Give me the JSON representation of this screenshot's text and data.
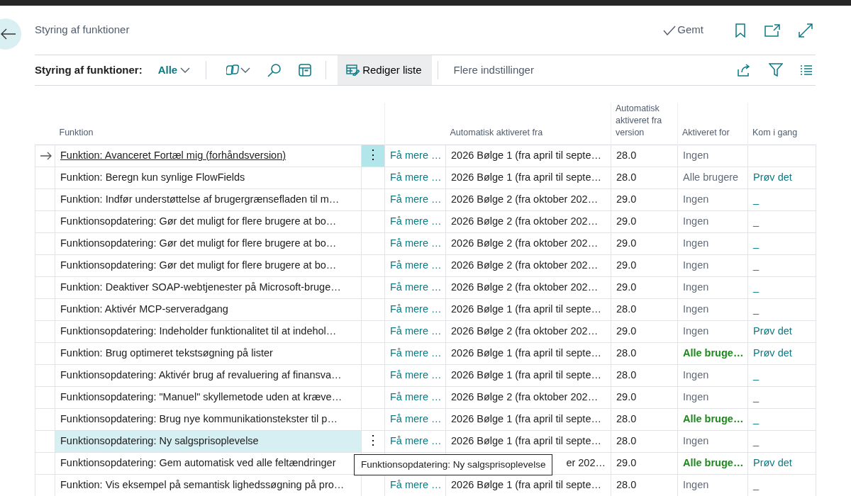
{
  "header": {
    "title": "Styring af funktioner",
    "save_status": "Gemt"
  },
  "toolbar": {
    "label": "Styring af funktioner:",
    "view": "Alle",
    "edit_button": "Rediger liste",
    "more": "Flere indstillinger"
  },
  "table": {
    "columns": [
      "Funktion",
      "Automatisk aktiveret fra",
      "Automatisk aktiveret fra version",
      "Aktiveret for",
      "Kom i gang"
    ],
    "rows": [
      {
        "feature": "Funktion: Avanceret Fortæl mig (forhåndsversion)",
        "selected": true,
        "hovered": false,
        "actions": "⋮",
        "learn": "Få mere …",
        "auto_from": "2026 Bølge 1 (fra april til septe…",
        "version": "28.0",
        "enabled_for": "Ingen",
        "enabled_all": false
      },
      {
        "feature": "Funktion: Beregn kun synlige FlowFields",
        "selected": false,
        "hovered": false,
        "learn": "Få mere …",
        "auto_from": "2026 Bølge 1 (fra april til septe…",
        "version": "28.0",
        "enabled_for": "Alle brugere",
        "enabled_all": false,
        "start": "Prøv det"
      },
      {
        "feature": "Funktion: Indfør understøttelse af brugergrænsefladen til m…",
        "selected": false,
        "hovered": false,
        "learn": "Få mere …",
        "auto_from": "2026 Bølge 2 (fra oktober 202…",
        "version": "29.0",
        "enabled_for": "Ingen",
        "enabled_all": false,
        "start": "_"
      },
      {
        "feature": "Funktionsopdatering: Gør det muligt for flere brugere at bo…",
        "selected": false,
        "hovered": false,
        "learn": "Få mere …",
        "auto_from": "2026 Bølge 2 (fra oktober 202…",
        "version": "29.0",
        "enabled_for": "Ingen",
        "enabled_all": false,
        "start": "_"
      },
      {
        "feature": "Funktionsopdatering: Gør det muligt for flere brugere at bo…",
        "selected": false,
        "hovered": false,
        "learn": "Få mere …",
        "auto_from": "2026 Bølge 2 (fra oktober 202…",
        "version": "29.0",
        "enabled_for": "Ingen",
        "enabled_all": false,
        "start": "_"
      },
      {
        "feature": "Funktionsopdatering: Gør det muligt for flere brugere at bo…",
        "selected": false,
        "hovered": false,
        "learn": "Få mere …",
        "auto_from": "2026 Bølge 2 (fra oktober 202…",
        "version": "29.0",
        "enabled_for": "Ingen",
        "enabled_all": false,
        "start": "_"
      },
      {
        "feature": "Funktion: Deaktiver SOAP-webtjenester på Microsoft-bruge…",
        "selected": false,
        "hovered": false,
        "learn": "Få mere …",
        "auto_from": "2026 Bølge 2 (fra oktober 202…",
        "version": "29.0",
        "enabled_for": "Ingen",
        "enabled_all": false,
        "start": "_"
      },
      {
        "feature": "Funktion: Aktivér MCP-serveradgang",
        "selected": false,
        "hovered": false,
        "learn": "Få mere …",
        "auto_from": "2026 Bølge 1 (fra april til septe…",
        "version": "28.0",
        "enabled_for": "Ingen",
        "enabled_all": false,
        "start": "_"
      },
      {
        "feature": "Funktionsopdatering: Indeholder funktionalitet til at indehol…",
        "selected": false,
        "hovered": false,
        "learn": "Få mere …",
        "auto_from": "2026 Bølge 2 (fra oktober 202…",
        "version": "29.0",
        "enabled_for": "Ingen",
        "enabled_all": false,
        "start": "Prøv det"
      },
      {
        "feature": "Funktion: Brug optimeret tekstsøgning på lister",
        "selected": false,
        "hovered": false,
        "learn": "Få mere …",
        "auto_from": "2026 Bølge 1 (fra april til septe…",
        "version": "28.0",
        "enabled_for": "Alle bruge…",
        "enabled_all": true,
        "start": "Prøv det"
      },
      {
        "feature": "Funktionsopdatering: Aktivér brug af revaluering af finansva…",
        "selected": false,
        "hovered": false,
        "learn": "Få mere …",
        "auto_from": "2026 Bølge 1 (fra april til septe…",
        "version": "28.0",
        "enabled_for": "Ingen",
        "enabled_all": false,
        "start": "_"
      },
      {
        "feature": "Funktionsopdatering: \"Manuel\" skyllemetode uden at kræve…",
        "selected": false,
        "hovered": false,
        "learn": "Få mere …",
        "auto_from": "2026 Bølge 2 (fra oktober 202…",
        "version": "29.0",
        "enabled_for": "Ingen",
        "enabled_all": false,
        "start": "_"
      },
      {
        "feature": "Funktionsopdatering: Brug nye kommunikationstekster til p…",
        "selected": false,
        "hovered": false,
        "learn": "Få mere …",
        "auto_from": "2026 Bølge 1 (fra april til septe…",
        "version": "28.0",
        "enabled_for": "Alle bruge…",
        "enabled_all": true,
        "start": "_"
      },
      {
        "feature": "Funktionsopdatering: Ny salgsprisoplevelse",
        "selected": false,
        "hovered": true,
        "actions": "⋮",
        "learn": "Få mere …",
        "auto_from": "2026 Bølge 1 (fra april til septe…",
        "version": "28.0",
        "enabled_for": "Ingen",
        "enabled_all": false,
        "start": "_"
      },
      {
        "feature": "Funktionsopdatering: Gem automatisk ved alle feltændringer",
        "selected": false,
        "hovered": false,
        "covered": true,
        "auto_from": "er 202…",
        "version": "29.0",
        "enabled_for": "Alle bruge…",
        "enabled_all": true,
        "start": "Prøv det"
      },
      {
        "feature": "Funktion: Vis eksempel på semantisk lighedssøgning på pro…",
        "selected": false,
        "hovered": false,
        "learn": "Få mere …",
        "auto_from": "2026 Bølge 1 (fra april til septe…",
        "version": "28.0",
        "enabled_for": "Ingen",
        "enabled_all": false,
        "start": "_"
      }
    ]
  },
  "tooltip": {
    "text": "Funktionsopdatering: Ny salgsprisoplevelse"
  }
}
